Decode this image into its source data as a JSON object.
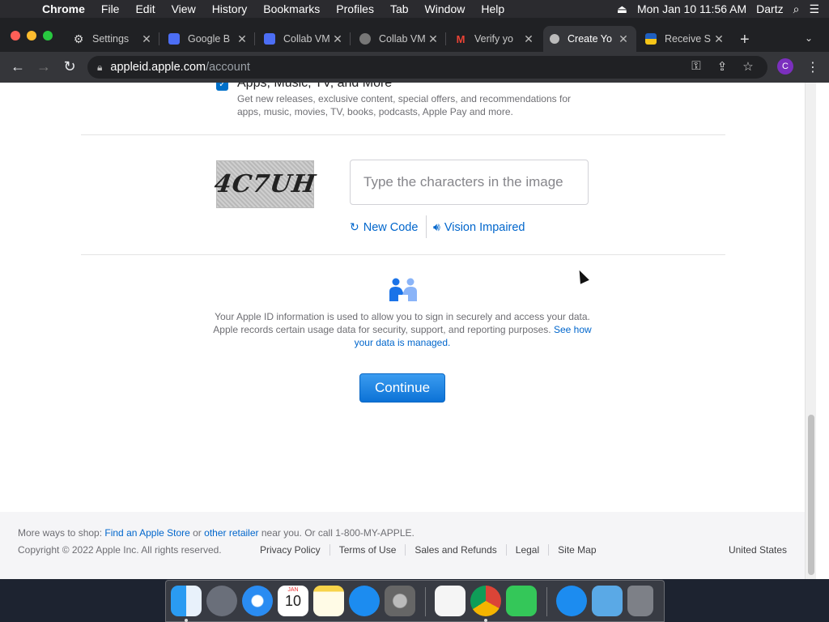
{
  "menubar": {
    "items": [
      "Chrome",
      "File",
      "Edit",
      "View",
      "History",
      "Bookmarks",
      "Profiles",
      "Tab",
      "Window",
      "Help"
    ],
    "clock": "Mon Jan 10  11:56 AM",
    "user": "Dartz"
  },
  "tabs": [
    {
      "title": "Settings",
      "icon": "gear-icon"
    },
    {
      "title": "Google B",
      "icon": "google-sites-icon"
    },
    {
      "title": "Collab VM",
      "icon": "google-sites-icon"
    },
    {
      "title": "Collab VM",
      "icon": "globe-icon"
    },
    {
      "title": "Verify yo",
      "icon": "gmail-icon"
    },
    {
      "title": "Create Yo",
      "icon": "apple-icon"
    },
    {
      "title": "Receive S",
      "icon": "sms-flag-icon"
    }
  ],
  "address": {
    "host": "appleid.apple.com",
    "path": "/account"
  },
  "profile_initial": "C",
  "option": {
    "title": "Apps, Music, TV, and More",
    "description": "Get new releases, exclusive content, special offers, and recommendations for apps, music, movies, TV, books, podcasts, Apple Pay and more."
  },
  "captcha": {
    "image_text": "4C7UH",
    "placeholder": "Type the characters in the image",
    "new_code": "New Code",
    "vision_impaired": "Vision Impaired"
  },
  "privacy": {
    "text": "Your Apple ID information is used to allow you to sign in securely and access your data. Apple records certain usage data for security, support, and reporting purposes.",
    "link": "See how your data is managed."
  },
  "continue_label": "Continue",
  "footer": {
    "shop_prefix": "More ways to shop: ",
    "find_store": "Find an Apple Store",
    "or": " or ",
    "other_retailer": "other retailer",
    "shop_suffix": " near you. Or call 1-800-MY-APPLE.",
    "copyright": "Copyright © 2022 Apple Inc. All rights reserved.",
    "links": [
      "Privacy Policy",
      "Terms of Use",
      "Sales and Refunds",
      "Legal",
      "Site Map"
    ],
    "country": "United States"
  },
  "dock": {
    "calendar_month": "JAN",
    "calendar_day": "10",
    "apps": [
      "finder",
      "launchpad",
      "safari",
      "calendar",
      "notes",
      "app-store",
      "system-preferences",
      "textedit",
      "chrome",
      "facetime",
      "downloads",
      "files",
      "trash"
    ]
  },
  "colors": {
    "accent": "#0066cc",
    "button": "#0c72d6",
    "menubar": "#2b2b2f",
    "tabstrip": "#202124",
    "toolbar": "#35363a",
    "footer": "#f5f5f7"
  }
}
